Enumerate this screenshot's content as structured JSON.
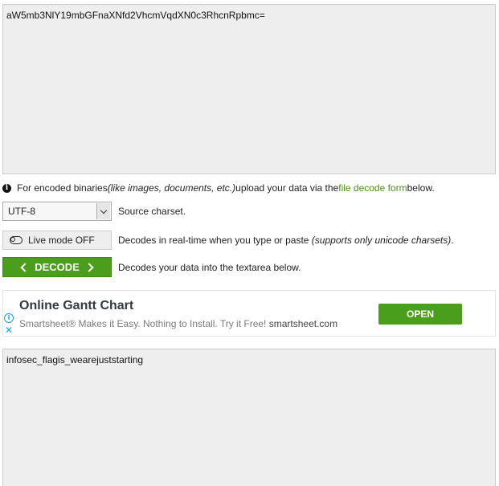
{
  "input": {
    "value": "aW5mb3NlY19mbGFnaXNfd2VhcmVqdXN0c3RhcnRpbmc="
  },
  "info": {
    "icon": "info-icon",
    "prefix": "For encoded binaries ",
    "italic": "(like images, documents, etc.)",
    "middle": " upload your data via the ",
    "link": "file decode form",
    "suffix": " below."
  },
  "charset": {
    "selected": "UTF-8",
    "description": "Source charset."
  },
  "live_mode": {
    "label": "Live mode OFF",
    "description": "Decodes in real-time when you type or paste ",
    "description_italic": "(supports only unicode charsets)",
    "description_end": "."
  },
  "decode": {
    "label": "DECODE",
    "description": "Decodes your data into the textarea below."
  },
  "ad": {
    "title": "Online Gantt Chart",
    "subtitle": "Smartsheet® Makes it Easy. Nothing to Install. Try it Free! ",
    "domain": "smartsheet.com",
    "button": "OPEN",
    "info_glyph": "i",
    "close_glyph": "✕"
  },
  "output": {
    "value": "infosec_flagis_wearejuststarting"
  },
  "colors": {
    "accent_green": "#4a9e1c",
    "link_green": "#4a8f17",
    "textarea_bg": "#eeeeee",
    "ad_blue": "#1a9be6"
  }
}
